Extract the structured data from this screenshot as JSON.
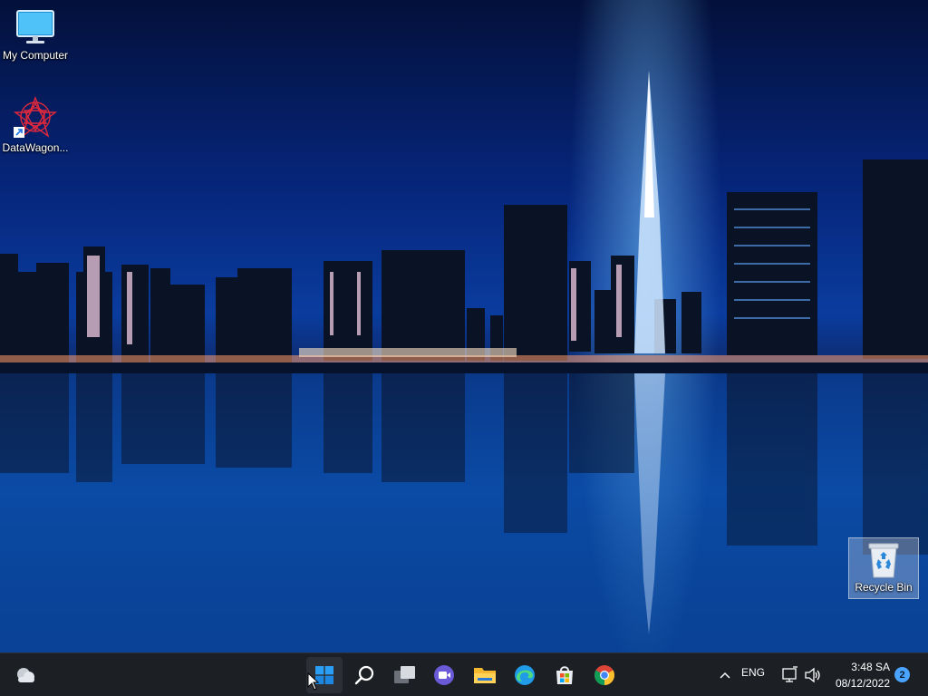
{
  "desktop": {
    "icons": [
      {
        "label": "My Computer"
      },
      {
        "label": "DataWagon..."
      },
      {
        "label": "Recycle Bin"
      }
    ]
  },
  "taskbar": {
    "apps": [
      "weather-icon",
      "start-icon",
      "search-icon",
      "task-view-icon",
      "chat-icon",
      "file-explorer-icon",
      "edge-icon",
      "store-icon",
      "chrome-icon"
    ],
    "tray": {
      "language": "ENG",
      "time": "3:48 SA",
      "date": "08/12/2022",
      "notifications": "2"
    }
  },
  "colors": {
    "taskbar_bg": "#1c1f24",
    "accent": "#4aa3ff"
  }
}
